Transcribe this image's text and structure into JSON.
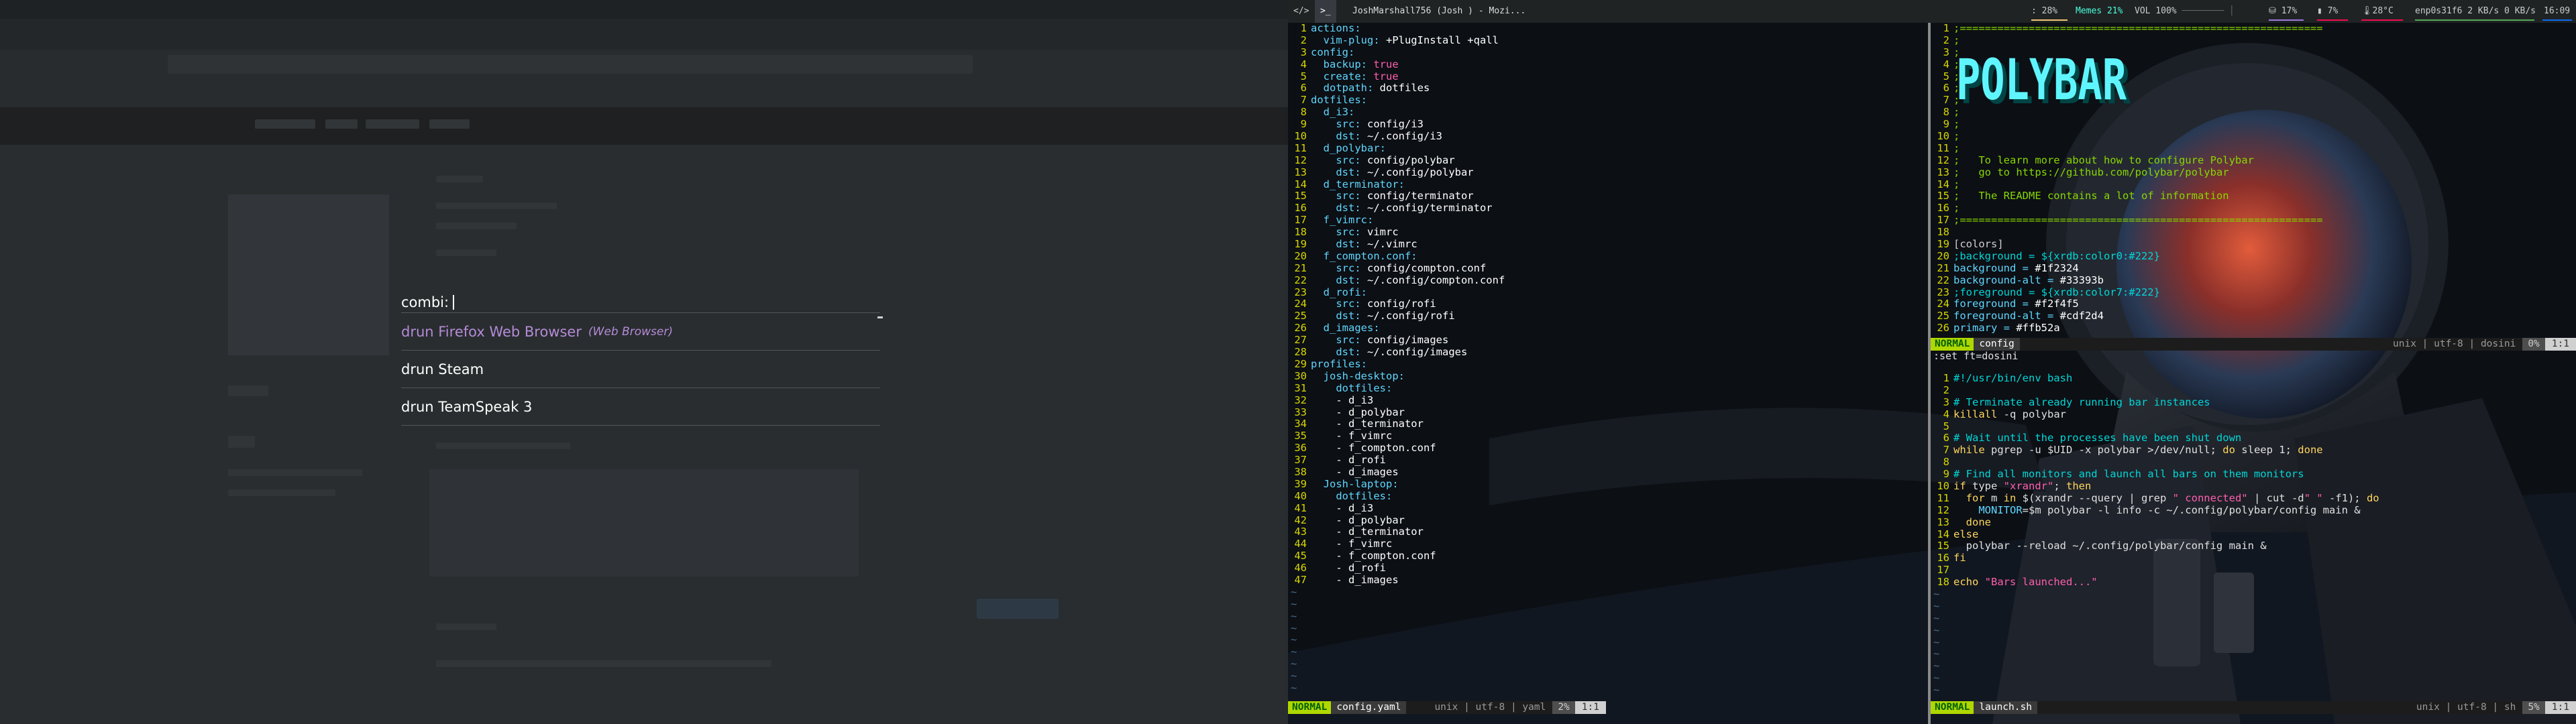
{
  "rofi": {
    "prompt": "combi:",
    "items": [
      {
        "label": "drun Firefox Web Browser",
        "sub": "(Web Browser)",
        "selected": true
      },
      {
        "label": "drun Steam",
        "sub": "",
        "selected": false
      },
      {
        "label": "drun TeamSpeak 3",
        "sub": "",
        "selected": false
      }
    ]
  },
  "polybar": {
    "workspaces": [
      "</>",
      ">_"
    ],
    "window_title": "JoshMarshall756 (Josh ) - Mozi...",
    "cpu": ": 28%",
    "memory": "Memes 21%",
    "volume": "VOL 100%",
    "disk": "17%",
    "battery": "7%",
    "temperature": "28°C",
    "network": "enp0s31f6 2 KB/s 0 KB/s",
    "clock": "16:09",
    "colors": {
      "cpu": "#f0c674",
      "memory": "#4bffdc",
      "disk": "#9f78e1",
      "temp": "#f50a4d",
      "net": "#55aa55",
      "clock": "#0a6cf5"
    }
  },
  "vim_left": {
    "mode": "NORMAL",
    "filename": "config.yaml",
    "encoding": "unix | utf-8 | yaml",
    "percent": "2%",
    "position": "1:1",
    "lines": [
      [
        [
          "c-key",
          "actions:"
        ]
      ],
      [
        [
          "c-key",
          "  vim-plug: "
        ],
        [
          "c-val",
          "+PlugInstall +qall"
        ]
      ],
      [
        [
          "c-key",
          "config:"
        ]
      ],
      [
        [
          "c-key",
          "  backup: "
        ],
        [
          "c-bool",
          "true"
        ]
      ],
      [
        [
          "c-key",
          "  create: "
        ],
        [
          "c-bool",
          "true"
        ]
      ],
      [
        [
          "c-key",
          "  dotpath: "
        ],
        [
          "c-val",
          "dotfiles"
        ]
      ],
      [
        [
          "c-key",
          "dotfiles:"
        ]
      ],
      [
        [
          "c-key",
          "  d_i3:"
        ]
      ],
      [
        [
          "c-key",
          "    src: "
        ],
        [
          "c-val",
          "config/i3"
        ]
      ],
      [
        [
          "c-key",
          "    dst: "
        ],
        [
          "c-val",
          "~/.config/i3"
        ]
      ],
      [
        [
          "c-key",
          "  d_polybar:"
        ]
      ],
      [
        [
          "c-key",
          "    src: "
        ],
        [
          "c-val",
          "config/polybar"
        ]
      ],
      [
        [
          "c-key",
          "    dst: "
        ],
        [
          "c-val",
          "~/.config/polybar"
        ]
      ],
      [
        [
          "c-key",
          "  d_terminator:"
        ]
      ],
      [
        [
          "c-key",
          "    src: "
        ],
        [
          "c-val",
          "config/terminator"
        ]
      ],
      [
        [
          "c-key",
          "    dst: "
        ],
        [
          "c-val",
          "~/.config/terminator"
        ]
      ],
      [
        [
          "c-key",
          "  f_vimrc:"
        ]
      ],
      [
        [
          "c-key",
          "    src: "
        ],
        [
          "c-val",
          "vimrc"
        ]
      ],
      [
        [
          "c-key",
          "    dst: "
        ],
        [
          "c-val",
          "~/.vimrc"
        ]
      ],
      [
        [
          "c-key",
          "  f_compton.conf:"
        ]
      ],
      [
        [
          "c-key",
          "    src: "
        ],
        [
          "c-val",
          "config/compton.conf"
        ]
      ],
      [
        [
          "c-key",
          "    dst: "
        ],
        [
          "c-val",
          "~/.config/compton.conf"
        ]
      ],
      [
        [
          "c-key",
          "  d_rofi:"
        ]
      ],
      [
        [
          "c-key",
          "    src: "
        ],
        [
          "c-val",
          "config/rofi"
        ]
      ],
      [
        [
          "c-key",
          "    dst: "
        ],
        [
          "c-val",
          "~/.config/rofi"
        ]
      ],
      [
        [
          "c-key",
          "  d_images:"
        ]
      ],
      [
        [
          "c-key",
          "    src: "
        ],
        [
          "c-val",
          "config/images"
        ]
      ],
      [
        [
          "c-key",
          "    dst: "
        ],
        [
          "c-val",
          "~/.config/images"
        ]
      ],
      [
        [
          "c-key",
          "profiles:"
        ]
      ],
      [
        [
          "c-key",
          "  josh-desktop:"
        ]
      ],
      [
        [
          "c-key",
          "    dotfiles:"
        ]
      ],
      [
        [
          "c-val",
          "    - d_i3"
        ]
      ],
      [
        [
          "c-val",
          "    - d_polybar"
        ]
      ],
      [
        [
          "c-val",
          "    - d_terminator"
        ]
      ],
      [
        [
          "c-val",
          "    - f_vimrc"
        ]
      ],
      [
        [
          "c-val",
          "    - f_compton.conf"
        ]
      ],
      [
        [
          "c-val",
          "    - d_rofi"
        ]
      ],
      [
        [
          "c-val",
          "    - d_images"
        ]
      ],
      [
        [
          "c-key",
          "  Josh-laptop:"
        ]
      ],
      [
        [
          "c-key",
          "    dotfiles:"
        ]
      ],
      [
        [
          "c-val",
          "    - d_i3"
        ]
      ],
      [
        [
          "c-val",
          "    - d_polybar"
        ]
      ],
      [
        [
          "c-val",
          "    - d_terminator"
        ]
      ],
      [
        [
          "c-val",
          "    - f_vimrc"
        ]
      ],
      [
        [
          "c-val",
          "    - f_compton.conf"
        ]
      ],
      [
        [
          "c-val",
          "    - d_rofi"
        ]
      ],
      [
        [
          "c-val",
          "    - d_images"
        ]
      ]
    ]
  },
  "vim_right_top": {
    "mode": "NORMAL",
    "filename": "config",
    "encoding": "unix | utf-8 | dosini",
    "percent": "0%",
    "position": "1:1",
    "banner": "POLYBAR",
    "lines": [
      [
        [
          "c-green",
          ";=========================================================="
        ]
      ],
      [
        [
          "c-green",
          ";"
        ]
      ],
      [
        [
          "c-green",
          ";"
        ]
      ],
      [
        [
          "c-green",
          ";"
        ]
      ],
      [
        [
          "c-green",
          ";"
        ]
      ],
      [
        [
          "c-green",
          ";"
        ]
      ],
      [
        [
          "c-green",
          ";"
        ]
      ],
      [
        [
          "c-green",
          ";"
        ]
      ],
      [
        [
          "c-green",
          ";"
        ]
      ],
      [
        [
          "c-green",
          ";"
        ]
      ],
      [
        [
          "c-green",
          ";"
        ]
      ],
      [
        [
          "c-green",
          ";   To learn more about how to configure Polybar"
        ]
      ],
      [
        [
          "c-green",
          ";   go to https://github.com/polybar/polybar"
        ]
      ],
      [
        [
          "c-green",
          ";"
        ]
      ],
      [
        [
          "c-green",
          ";   The README contains a lot of information"
        ]
      ],
      [
        [
          "c-green",
          ";"
        ]
      ],
      [
        [
          "c-green",
          ";=========================================================="
        ]
      ],
      [
        [
          "c-plain",
          ""
        ]
      ],
      [
        [
          "c-sect",
          "[colors]"
        ]
      ],
      [
        [
          "c-hash",
          ";background = ${xrdb:color0:#222}"
        ]
      ],
      [
        [
          "c-key",
          "background = "
        ],
        [
          "c-val",
          "#1f2324"
        ]
      ],
      [
        [
          "c-key",
          "background-alt = "
        ],
        [
          "c-val",
          "#33393b"
        ]
      ],
      [
        [
          "c-hash",
          ";foreground = ${xrdb:color7:#222}"
        ]
      ],
      [
        [
          "c-key",
          "foreground = "
        ],
        [
          "c-val",
          "#f2f4f5"
        ]
      ],
      [
        [
          "c-key",
          "foreground-alt = "
        ],
        [
          "c-val",
          "#cdf2d4"
        ]
      ],
      [
        [
          "c-key",
          "primary = "
        ],
        [
          "c-val",
          "#ffb52a"
        ]
      ]
    ]
  },
  "vim_right_bottom": {
    "cmdline": ":set ft=dosini",
    "mode": "NORMAL",
    "filename": "launch.sh",
    "encoding": "unix | utf-8 | sh",
    "percent": "5%",
    "position": "1:1",
    "lines": [
      [
        [
          "c-hash",
          "#!/usr/bin/env bash"
        ]
      ],
      [
        [
          "c-plain",
          ""
        ]
      ],
      [
        [
          "c-hash",
          "# Terminate already running bar instances"
        ]
      ],
      [
        [
          "c-str",
          "killall"
        ],
        [
          "c-plain",
          " -q polybar"
        ]
      ],
      [
        [
          "c-plain",
          ""
        ]
      ],
      [
        [
          "c-hash",
          "# Wait until the processes have been shut down"
        ]
      ],
      [
        [
          "c-str",
          "while"
        ],
        [
          "c-plain",
          " pgrep -u $UID -x polybar >/dev/null; "
        ],
        [
          "c-str",
          "do"
        ],
        [
          "c-plain",
          " sleep 1; "
        ],
        [
          "c-str",
          "done"
        ]
      ],
      [
        [
          "c-plain",
          ""
        ]
      ],
      [
        [
          "c-hash",
          "# Find all monitors and launch all bars on them monitors"
        ]
      ],
      [
        [
          "c-str",
          "if"
        ],
        [
          "c-plain",
          " type "
        ],
        [
          "c-bool",
          "\"xrandr\""
        ],
        [
          "c-plain",
          "; "
        ],
        [
          "c-str",
          "then"
        ]
      ],
      [
        [
          "c-plain",
          "  "
        ],
        [
          "c-str",
          "for"
        ],
        [
          "c-plain",
          " m "
        ],
        [
          "c-str",
          "in"
        ],
        [
          "c-plain",
          " $(xrandr --query | grep "
        ],
        [
          "c-bool",
          "\" connected\""
        ],
        [
          "c-plain",
          " | cut -d"
        ],
        [
          "c-bool",
          "\" \""
        ],
        [
          "c-plain",
          " -f1); "
        ],
        [
          "c-str",
          "do"
        ]
      ],
      [
        [
          "c-plain",
          "    "
        ],
        [
          "c-key",
          "MONITOR"
        ],
        [
          "c-plain",
          "=$m polybar -l info -c ~/.config/polybar/config main &"
        ]
      ],
      [
        [
          "c-str",
          "  done"
        ]
      ],
      [
        [
          "c-str",
          "else"
        ]
      ],
      [
        [
          "c-plain",
          "  polybar --reload ~/.config/polybar/config main &"
        ]
      ],
      [
        [
          "c-str",
          "fi"
        ]
      ],
      [
        [
          "c-plain",
          ""
        ]
      ],
      [
        [
          "c-str",
          "echo"
        ],
        [
          "c-plain",
          " "
        ],
        [
          "c-bool",
          "\"Bars launched...\""
        ]
      ]
    ]
  }
}
